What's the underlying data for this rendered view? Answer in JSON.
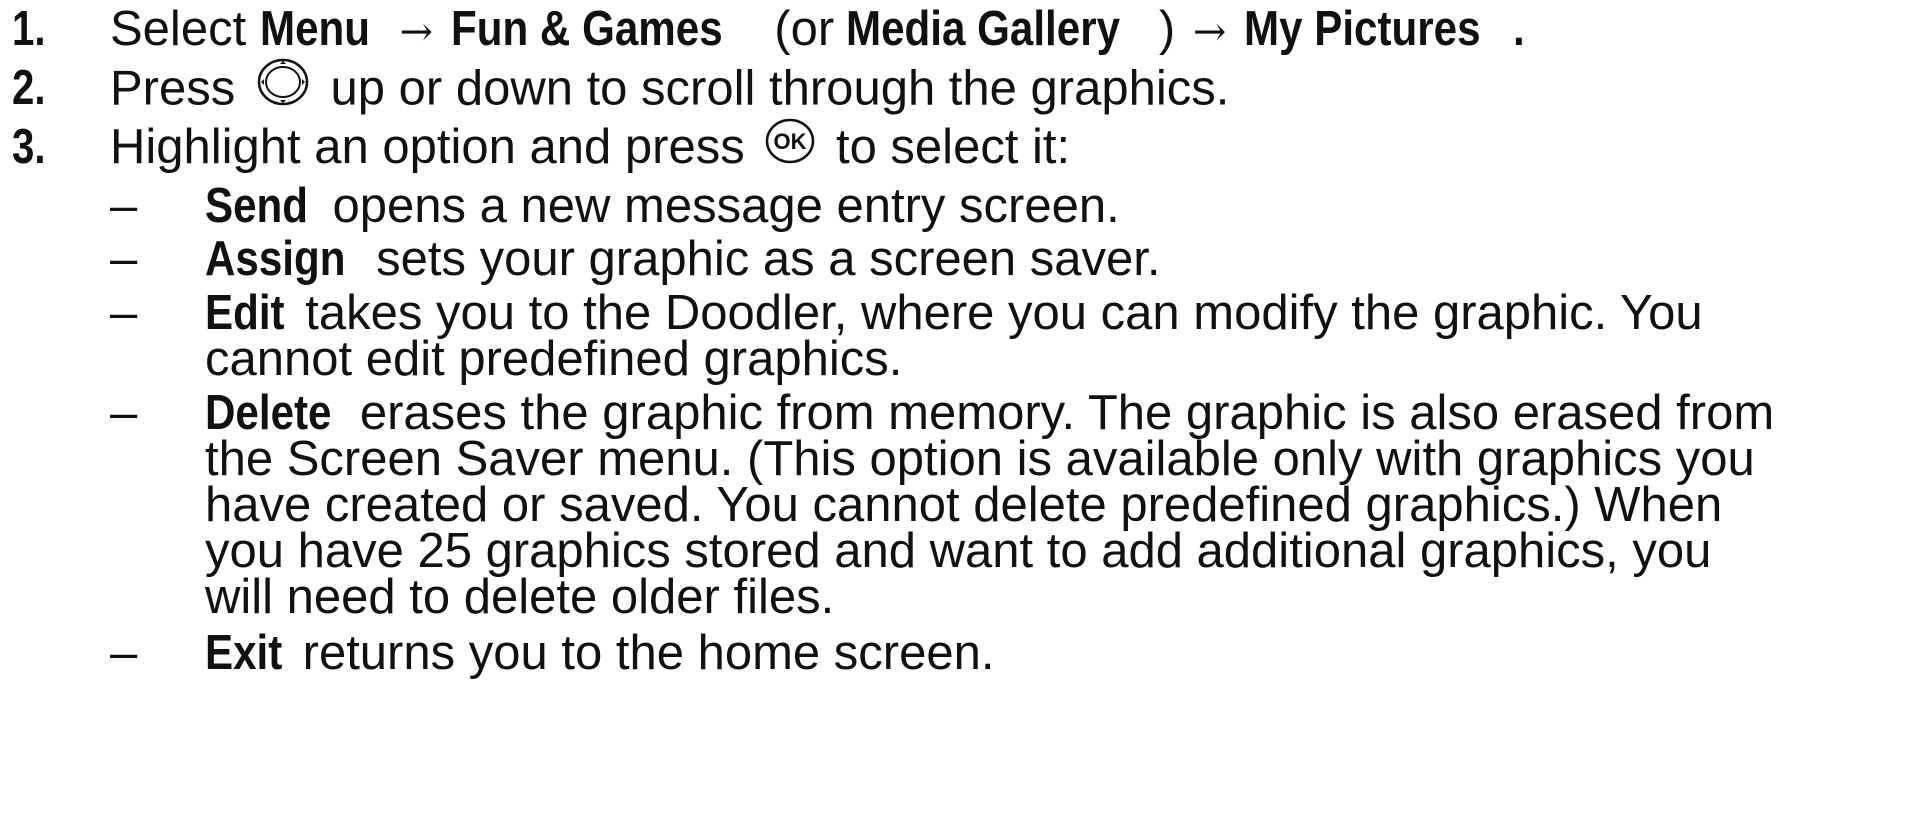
{
  "steps": [
    {
      "number": "1.",
      "select": "Select",
      "menu": "Menu",
      "arrow1": "→",
      "fun_games": "Fun & Games",
      "or_open": "(or",
      "media_gallery": "Media Gallery",
      "close": ")",
      "arrow2": "→",
      "my_pictures": "My Pictures",
      "period": "."
    },
    {
      "number": "2.",
      "press": "Press",
      "icon": "navigation-key-icon",
      "rest": "up or down to scroll through the graphics."
    },
    {
      "number": "3.",
      "intro": "Highlight an option and press",
      "icon": "ok-key-icon",
      "rest": "to select it:"
    }
  ],
  "dash": "–",
  "options": {
    "send": {
      "label": "Send",
      "desc": "opens a new message entry screen."
    },
    "assign": {
      "label": "Assign",
      "desc": "sets your graphic as a screen saver."
    },
    "edit": {
      "label": "Edit",
      "line1": "takes you to the Doodler, where you can modify the graphic. You",
      "line2": "cannot edit predefined graphics."
    },
    "delete": {
      "label": "Delete",
      "line1": "erases the graphic from memory. The graphic is also erased from",
      "line2": "the Screen Saver menu. (This option is available only with graphics you",
      "line3": "have created or saved. You cannot delete predefined graphics.) When",
      "line4": "you have 25 graphics stored and want to add additional graphics, you",
      "line5": "will need to delete older files."
    },
    "exit": {
      "label": "Exit",
      "desc": "returns you to the home screen."
    }
  }
}
